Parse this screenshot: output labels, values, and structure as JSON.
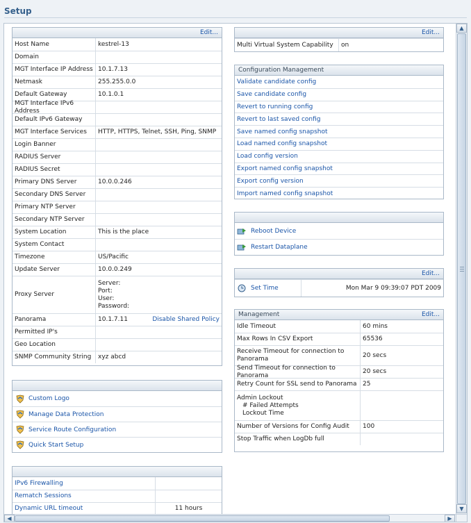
{
  "page_title": "Setup",
  "edit_label": "Edit...",
  "general": {
    "rows": [
      {
        "label": "Host Name",
        "value": "kestrel-13"
      },
      {
        "label": "Domain",
        "value": ""
      },
      {
        "label": "MGT Interface IP Address",
        "value": "10.1.7.13"
      },
      {
        "label": "Netmask",
        "value": "255.255.0.0"
      },
      {
        "label": "Default Gateway",
        "value": "10.1.0.1"
      },
      {
        "label": "MGT Interface IPv6 Address",
        "value": ""
      },
      {
        "label": "Default IPv6 Gateway",
        "value": ""
      },
      {
        "label": "MGT Interface Services",
        "value": "HTTP, HTTPS, Telnet, SSH, Ping, SNMP"
      },
      {
        "label": "Login Banner",
        "value": ""
      },
      {
        "label": "RADIUS Server",
        "value": ""
      },
      {
        "label": "RADIUS Secret",
        "value": ""
      },
      {
        "label": "Primary DNS Server",
        "value": "10.0.0.246"
      },
      {
        "label": "Secondary DNS Server",
        "value": ""
      },
      {
        "label": "Primary NTP Server",
        "value": ""
      },
      {
        "label": "Secondary NTP Server",
        "value": ""
      },
      {
        "label": "System Location",
        "value": "This is the place"
      },
      {
        "label": "System Contact",
        "value": ""
      },
      {
        "label": "Timezone",
        "value": "US/Pacific"
      },
      {
        "label": "Update Server",
        "value": "10.0.0.249"
      }
    ],
    "proxy": {
      "label": "Proxy Server",
      "lines": [
        "Server:",
        "Port:",
        "User:",
        "Password:"
      ]
    },
    "panorama": {
      "label": "Panorama",
      "value": "10.1.7.11",
      "link": "Disable Shared Policy"
    },
    "rows_after": [
      {
        "label": "Permitted IP's",
        "value": ""
      },
      {
        "label": "Geo Location",
        "value": ""
      },
      {
        "label": "SNMP Community String",
        "value": "xyz abcd"
      }
    ]
  },
  "tools": [
    {
      "label": "Custom Logo",
      "icon": "shield-icon"
    },
    {
      "label": "Manage Data Protection",
      "icon": "shield-icon"
    },
    {
      "label": "Service Route Configuration",
      "icon": "shield-icon"
    },
    {
      "label": "Quick Start Setup",
      "icon": "shield-icon"
    }
  ],
  "misc": {
    "rows": [
      {
        "label": "IPv6 Firewalling",
        "value": ""
      },
      {
        "label": "Rematch Sessions",
        "value": ""
      },
      {
        "label": "Dynamic URL timeout",
        "value": "11 hours"
      }
    ]
  },
  "mvsys": {
    "label": "Multi Virtual System Capability",
    "value": "on"
  },
  "config_mgmt": {
    "title": "Configuration Management",
    "links": [
      "Validate candidate config",
      "Save candidate config",
      "Revert to running config",
      "Revert to last saved config",
      "Save named config snapshot",
      "Load named config snapshot",
      "Load config version",
      "Export named config snapshot",
      "Export config version",
      "Import named config snapshot"
    ]
  },
  "device_ops": [
    {
      "label": "Reboot Device",
      "icon": "reboot-icon"
    },
    {
      "label": "Restart Dataplane",
      "icon": "restart-icon"
    }
  ],
  "time": {
    "label": "Set Time",
    "value": "Mon Mar 9 09:39:07 PDT 2009"
  },
  "management": {
    "title": "Management",
    "rows": [
      {
        "label": "Idle Timeout",
        "value": "60 mins"
      },
      {
        "label": "Max Rows In CSV Export",
        "value": "65536"
      },
      {
        "label": "Receive Timeout for connection to Panorama",
        "value": "20 secs"
      },
      {
        "label": "Send Timeout for connection to Panorama",
        "value": "20 secs"
      },
      {
        "label": "Retry Count for SSL send to Panorama",
        "value": "25"
      }
    ],
    "admin_lockout": {
      "lines": [
        "Admin Lockout",
        "# Failed Attempts",
        "Lockout Time"
      ]
    },
    "rows_after": [
      {
        "label": "Number of Versions for Config Audit",
        "value": "100"
      },
      {
        "label": "Stop Traffic when LogDb full",
        "value": ""
      }
    ]
  },
  "colors": {
    "accent": "#35608c",
    "link": "#1a55a8",
    "border": "#a9b8c8"
  }
}
